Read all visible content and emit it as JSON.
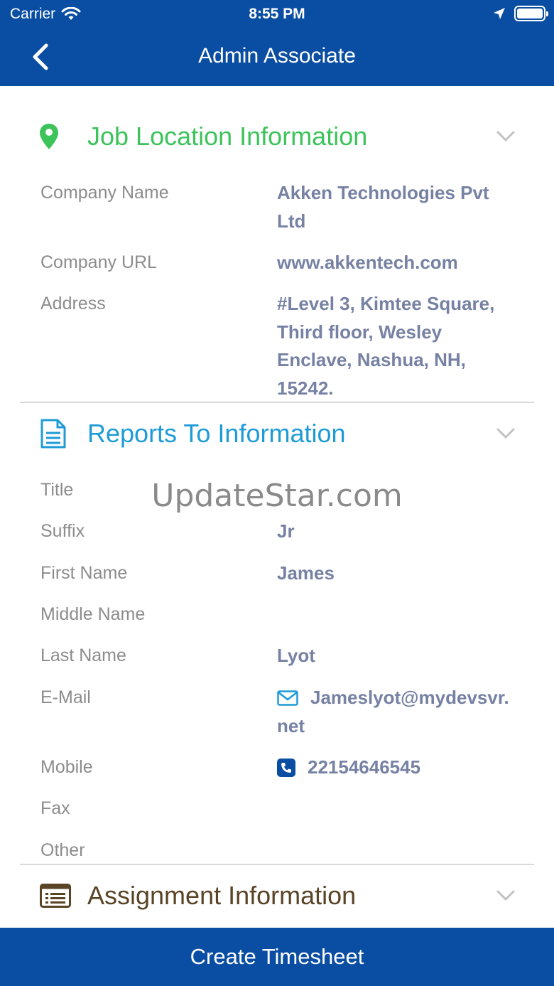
{
  "status_bar": {
    "carrier": "Carrier",
    "time": "8:55 PM"
  },
  "nav": {
    "title": "Admin Associate"
  },
  "sections": {
    "job_location": {
      "title": "Job Location Information",
      "company_name_label": "Company Name",
      "company_name_value": "Akken Technologies Pvt Ltd",
      "company_url_label": "Company URL",
      "company_url_value": "www.akkentech.com",
      "address_label": "Address",
      "address_value": "#Level 3, Kimtee Square, Third floor, Wesley Enclave, Nashua, NH, 15242."
    },
    "reports_to": {
      "title": "Reports To Information",
      "title_label": "Title",
      "suffix_label": "Suffix",
      "suffix_value": "Jr",
      "first_name_label": "First Name",
      "first_name_value": "James",
      "middle_name_label": "Middle Name",
      "last_name_label": "Last Name",
      "last_name_value": "Lyot",
      "email_label": "E-Mail",
      "email_value": "Jameslyot@mydevsvr.net",
      "mobile_label": "Mobile",
      "mobile_value": "22154646545",
      "fax_label": "Fax",
      "other_label": "Other"
    },
    "assignment": {
      "title": "Assignment Information"
    }
  },
  "watermark": "UpdateStar.com",
  "footer": {
    "create_timesheet": "Create Timesheet"
  },
  "colors": {
    "brand": "#0a4ea3",
    "job_green": "#3cc35a",
    "reports_blue": "#1e9bd7",
    "assignment_brown": "#5a4426"
  }
}
